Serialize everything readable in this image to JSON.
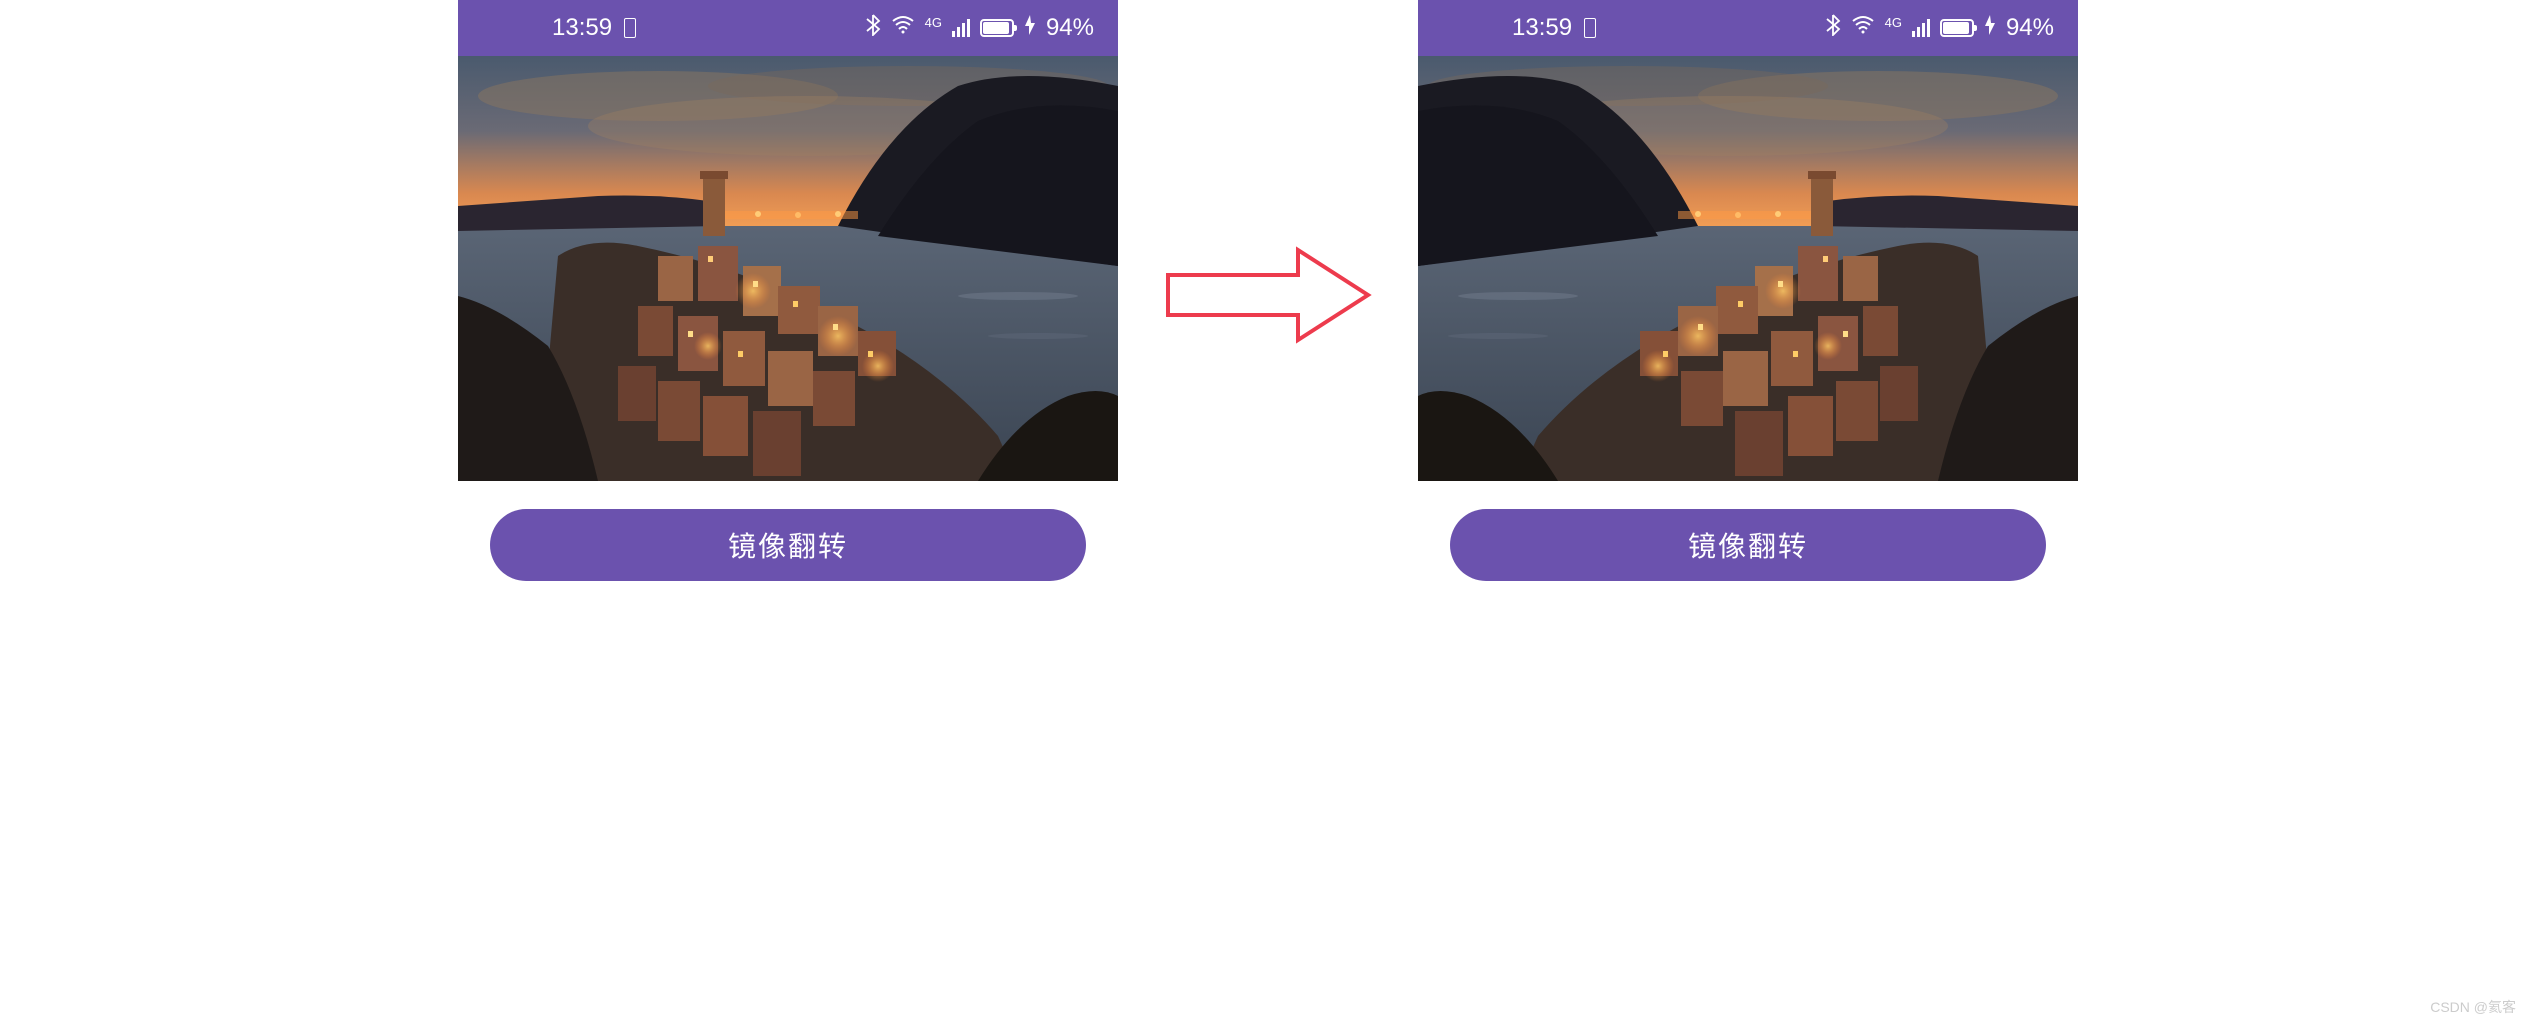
{
  "status_bar": {
    "time": "13:59",
    "network_type": "4G",
    "battery_percent": "94%"
  },
  "screens": {
    "left": {
      "button_label": "镜像翻转",
      "image_mirrored": false
    },
    "right": {
      "button_label": "镜像翻转",
      "image_mirrored": true
    }
  },
  "watermark": "CSDN @氦客",
  "colors": {
    "primary": "#6b52ae",
    "arrow": "#ed3b4d"
  }
}
